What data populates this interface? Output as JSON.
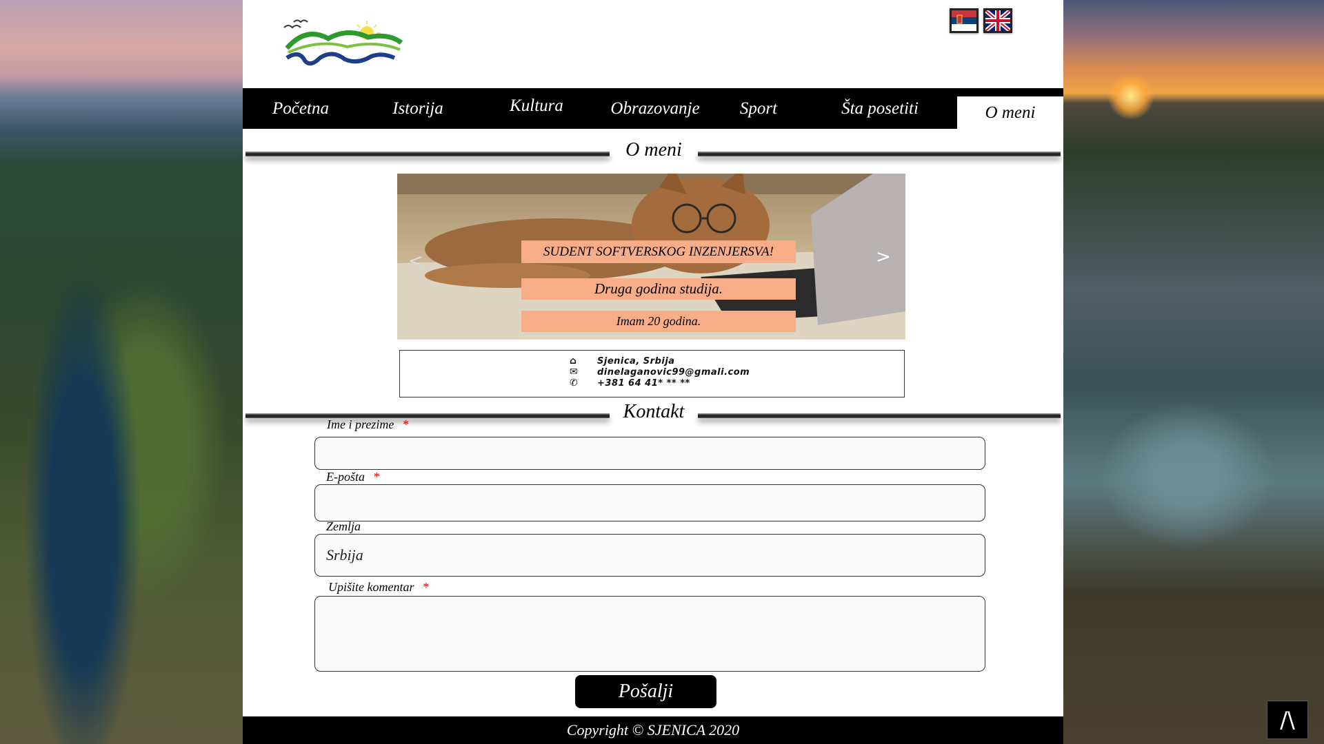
{
  "nav": {
    "items": [
      "Početna",
      "Istorija",
      "Kultura",
      "Obrazovanje",
      "Sport",
      "Šta posetiti",
      "O meni"
    ],
    "active": "O meni"
  },
  "languages": [
    "Srpski",
    "English"
  ],
  "sections": {
    "about_title": "O meni",
    "contact_title": "Kontakt"
  },
  "slider": {
    "prev_label": "<",
    "next_label": ">",
    "captions": [
      "SUDENT SOFTVERSKOG INZENJERSVA!",
      "Druga godina studija.",
      "Imam 20 godina."
    ]
  },
  "contact_info": {
    "address": "Sjenica, Srbija",
    "email": "dinelaganovic99@gmali.com",
    "phone": "+381 64 41* ** **",
    "icons": [
      "home-icon",
      "envelope-icon",
      "phone-icon"
    ]
  },
  "form": {
    "name_label": "Ime i prezime",
    "email_label": "E-pošta",
    "country_label": "Zemlja",
    "country_value": "Srbija",
    "comment_label": "Upišite komentar",
    "required_mark": "*",
    "submit_label": "Pošalji"
  },
  "footer": {
    "copyright": "Copyright © SJENICA 2020"
  },
  "back_to_top": "/\\",
  "colors": {
    "nav_bg": "#000000",
    "caption_bg": "#f7ad87",
    "required": "#e00000",
    "page_bg": "#ffffff"
  }
}
